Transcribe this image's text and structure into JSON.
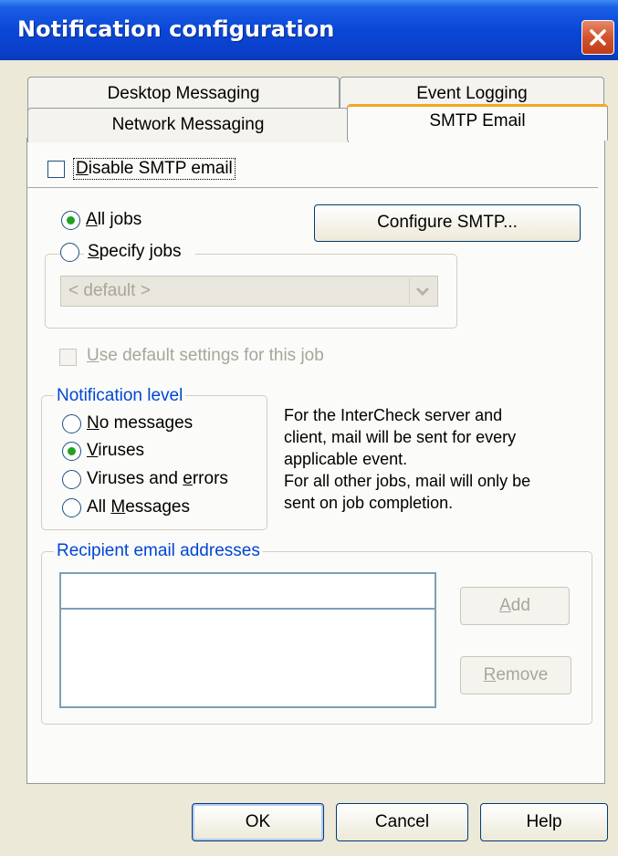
{
  "window": {
    "title": "Notification configuration"
  },
  "tabs": {
    "desktop_messaging": "Desktop Messaging",
    "event_logging": "Event Logging",
    "network_messaging": "Network Messaging",
    "smtp_email": "SMTP Email"
  },
  "smtp": {
    "disable_pre": "D",
    "disable_rest": "isable SMTP email",
    "disable_checked": false,
    "all_jobs_pre": "A",
    "all_jobs_rest": "ll jobs",
    "specify_jobs_pre": "S",
    "specify_jobs_rest": "pecify jobs",
    "job_select_value": "< default >",
    "configure_label": "Configure SMTP...",
    "use_default_pre": "U",
    "use_default_rest": "se default settings for this job"
  },
  "notification_level": {
    "legend": "Notification level",
    "no_messages_pre": "N",
    "no_messages_rest": "o messages",
    "viruses_pre": "V",
    "viruses_rest": "iruses",
    "errors_a": "Viruses and ",
    "errors_u": "e",
    "errors_b": "rrors",
    "all_a": "All ",
    "all_u": "M",
    "all_b": "essages",
    "selected": "Viruses"
  },
  "info_text": [
    "For the InterCheck server and",
    "client, mail will be sent for every",
    "applicable event.",
    "For all other jobs, mail will only be",
    "sent on job completion."
  ],
  "recipients": {
    "legend": "Recipient email addresses",
    "input_value": "",
    "add_pre": "A",
    "add_rest": "dd",
    "remove_pre": "R",
    "remove_rest": "emove"
  },
  "footer": {
    "ok": "OK",
    "cancel": "Cancel",
    "help": "Help"
  },
  "colors": {
    "title_bar": "#0a47d6",
    "selected_radio": "#21a121",
    "group_label": "#0046d5",
    "active_tab": "#f5a623"
  }
}
